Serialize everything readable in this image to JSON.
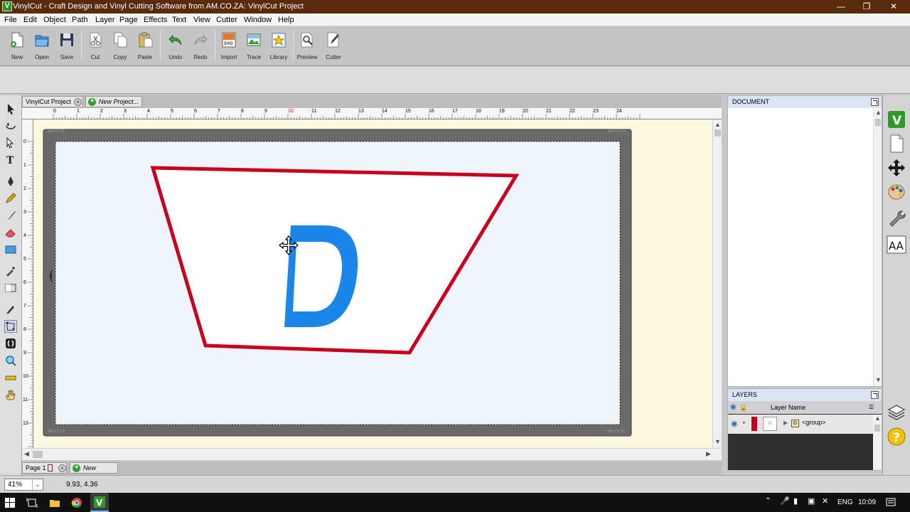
{
  "window": {
    "title": "VinylCut - Craft Design and Vinyl Cutting Software from AM.CO.ZA: VinylCut Project",
    "app_icon_letter": "V",
    "controls": [
      "minimize",
      "restore",
      "close"
    ]
  },
  "menu": [
    "File",
    "Edit",
    "Object",
    "Path",
    "Layer",
    "Page",
    "Effects",
    "Text",
    "View",
    "Cutter",
    "Window",
    "Help"
  ],
  "toolbar": {
    "new": "New",
    "open": "Open",
    "save": "Save",
    "cut": "Cut",
    "copy": "Copy",
    "paste": "Paste",
    "undo": "Undo",
    "redo": "Redo",
    "import": "Import",
    "trace": "Trace",
    "library": "Library",
    "preview": "Preview",
    "cutter": "Cutter"
  },
  "tabs": {
    "document": "VinylCut Project",
    "new_project": "New Project..."
  },
  "ruler": {
    "horizontal": [
      "0",
      "1",
      "2",
      "3",
      "4",
      "5",
      "6",
      "7",
      "8",
      "9",
      "10",
      "11",
      "12",
      "13",
      "14",
      "15",
      "16",
      "17",
      "18",
      "19",
      "20",
      "21",
      "22",
      "23",
      "24"
    ],
    "vertical": [
      "0",
      "1",
      "2",
      "3",
      "4",
      "5",
      "6",
      "7",
      "8",
      "9",
      "10",
      "11",
      "12"
    ]
  },
  "canvas": {
    "mat_label": "AM.CO.ZA",
    "letter": "D",
    "shape_stroke_color": "#c8001e",
    "letter_color": "#1a86ea"
  },
  "pages": {
    "current": "Page 1",
    "new_page": "New Page..."
  },
  "panels": {
    "document_title": "DOCUMENT",
    "layers_title": "LAYERS",
    "layers_col": "Layer Name",
    "layer_row": {
      "name": "<group>",
      "thumb_label": "0",
      "color": "#c8001e"
    }
  },
  "status": {
    "zoom": "41%",
    "coords": "9.93, 4.36"
  },
  "taskbar": {
    "language": "ENG",
    "time": "10:09"
  },
  "colors": {
    "titlebar": "#5a2a0c",
    "workspace": "#fcf8e0",
    "panel_header": "#d9e4f5"
  }
}
